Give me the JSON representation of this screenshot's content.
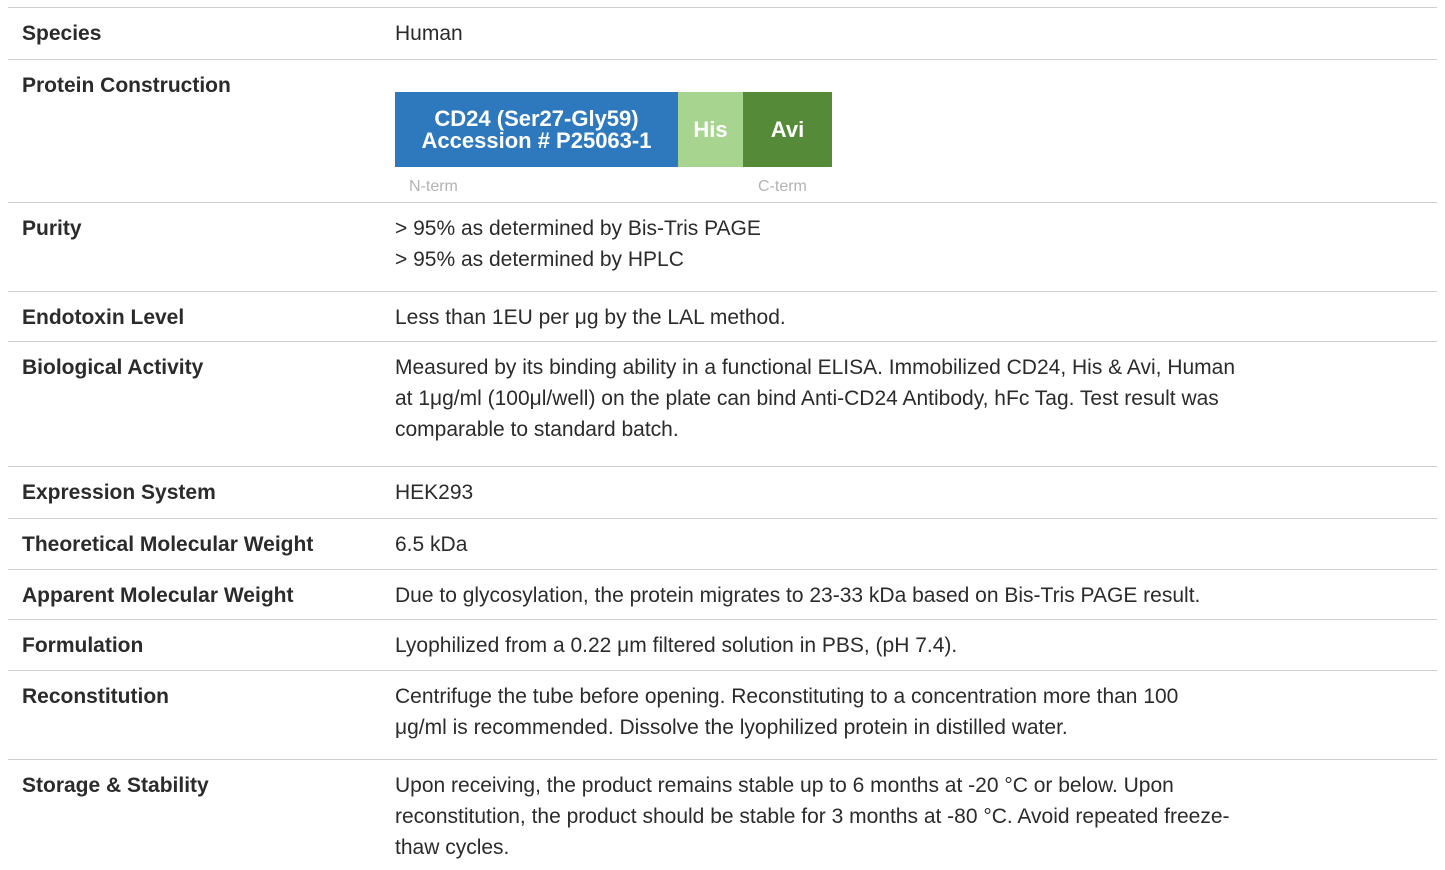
{
  "rows": {
    "species": {
      "label": "Species",
      "value": "Human"
    },
    "construction": {
      "label": "Protein Construction",
      "segments": {
        "main_line1": "CD24 (Ser27-Gly59)",
        "main_line2": "Accession # P25063-1",
        "his": "His",
        "avi": "Avi"
      },
      "n_term": "N-term",
      "c_term": "C-term",
      "colors": {
        "main": "#2e79bd",
        "his": "#a7d58f",
        "avi": "#558a39"
      }
    },
    "purity": {
      "label": "Purity",
      "lines": [
        "> 95% as determined by Bis-Tris PAGE",
        "> 95% as determined by HPLC"
      ]
    },
    "endotoxin": {
      "label": "Endotoxin Level",
      "value": "Less than 1EU per μg by the LAL method."
    },
    "activity": {
      "label": "Biological Activity",
      "lines": [
        "Measured by its binding ability in a functional ELISA. Immobilized CD24, His & Avi, Human",
        "at 1μg/ml (100μl/well) on the plate can bind Anti-CD24 Antibody, hFc Tag. Test result was",
        "comparable to standard batch."
      ]
    },
    "expression": {
      "label": "Expression System",
      "value": "HEK293"
    },
    "theoretical_mw": {
      "label": "Theoretical Molecular Weight",
      "value": "6.5 kDa"
    },
    "apparent_mw": {
      "label": "Apparent Molecular Weight",
      "value": "Due to glycosylation, the protein migrates to 23-33 kDa based on Bis-Tris PAGE result."
    },
    "formulation": {
      "label": "Formulation",
      "value": "Lyophilized from a 0.22 μm filtered solution in PBS, (pH 7.4)."
    },
    "reconstitution": {
      "label": "Reconstitution",
      "lines": [
        "Centrifuge the tube before opening. Reconstituting to a concentration more than 100",
        "μg/ml is recommended. Dissolve the lyophilized protein in distilled water."
      ]
    },
    "storage": {
      "label": "Storage & Stability",
      "lines": [
        "Upon receiving, the product remains stable up to 6 months at -20 °C or below. Upon",
        "reconstitution, the product should be stable for 3 months at -80 °C. Avoid repeated freeze-",
        "thaw cycles."
      ]
    }
  }
}
